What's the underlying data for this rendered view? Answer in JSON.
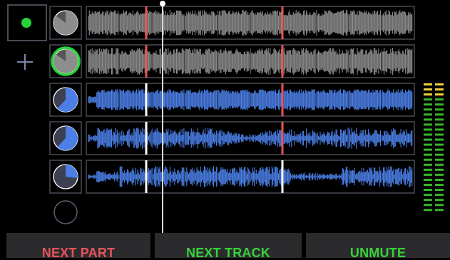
{
  "colors": {
    "background": "#000000",
    "accent_green": "#27d43a",
    "armed_red": "#e7535a",
    "muted_gray": "#8a8a8a",
    "active_blue": "#4b7fe6",
    "meter_yellow": "#f0cf3e",
    "meter_green": "#39b52b",
    "footer_bg": "#2b2b2e"
  },
  "controls": {
    "record_indicator": {
      "icon": "green-dot",
      "state": "recording"
    },
    "add_track": {
      "icon": "plus-icon"
    }
  },
  "tracks": [
    {
      "id": 1,
      "state": "muted",
      "pie_progress": 0.85,
      "selected": false,
      "marker_style": "red",
      "waveform_color": "gray"
    },
    {
      "id": 2,
      "state": "muted",
      "pie_progress": 0.85,
      "selected": true,
      "marker_style": "red",
      "waveform_color": "gray"
    },
    {
      "id": 3,
      "state": "active",
      "pie_progress": 0.62,
      "selected": false,
      "marker_style": "mixed",
      "waveform_color": "blue"
    },
    {
      "id": 4,
      "state": "active",
      "pie_progress": 0.62,
      "selected": false,
      "marker_style": "mixed",
      "waveform_color": "blue"
    },
    {
      "id": 5,
      "state": "active",
      "pie_progress": 0.27,
      "selected": false,
      "marker_style": "white",
      "waveform_color": "blue"
    },
    {
      "id": 6,
      "state": "empty",
      "pie_progress": 0,
      "selected": false
    }
  ],
  "level_meter": {
    "left_level": 0.92,
    "right_level": 0.92
  },
  "footer": {
    "next_part_label": "NEXT PART",
    "next_track_label": "NEXT TRACK",
    "unmute_label": "UNMUTE"
  }
}
